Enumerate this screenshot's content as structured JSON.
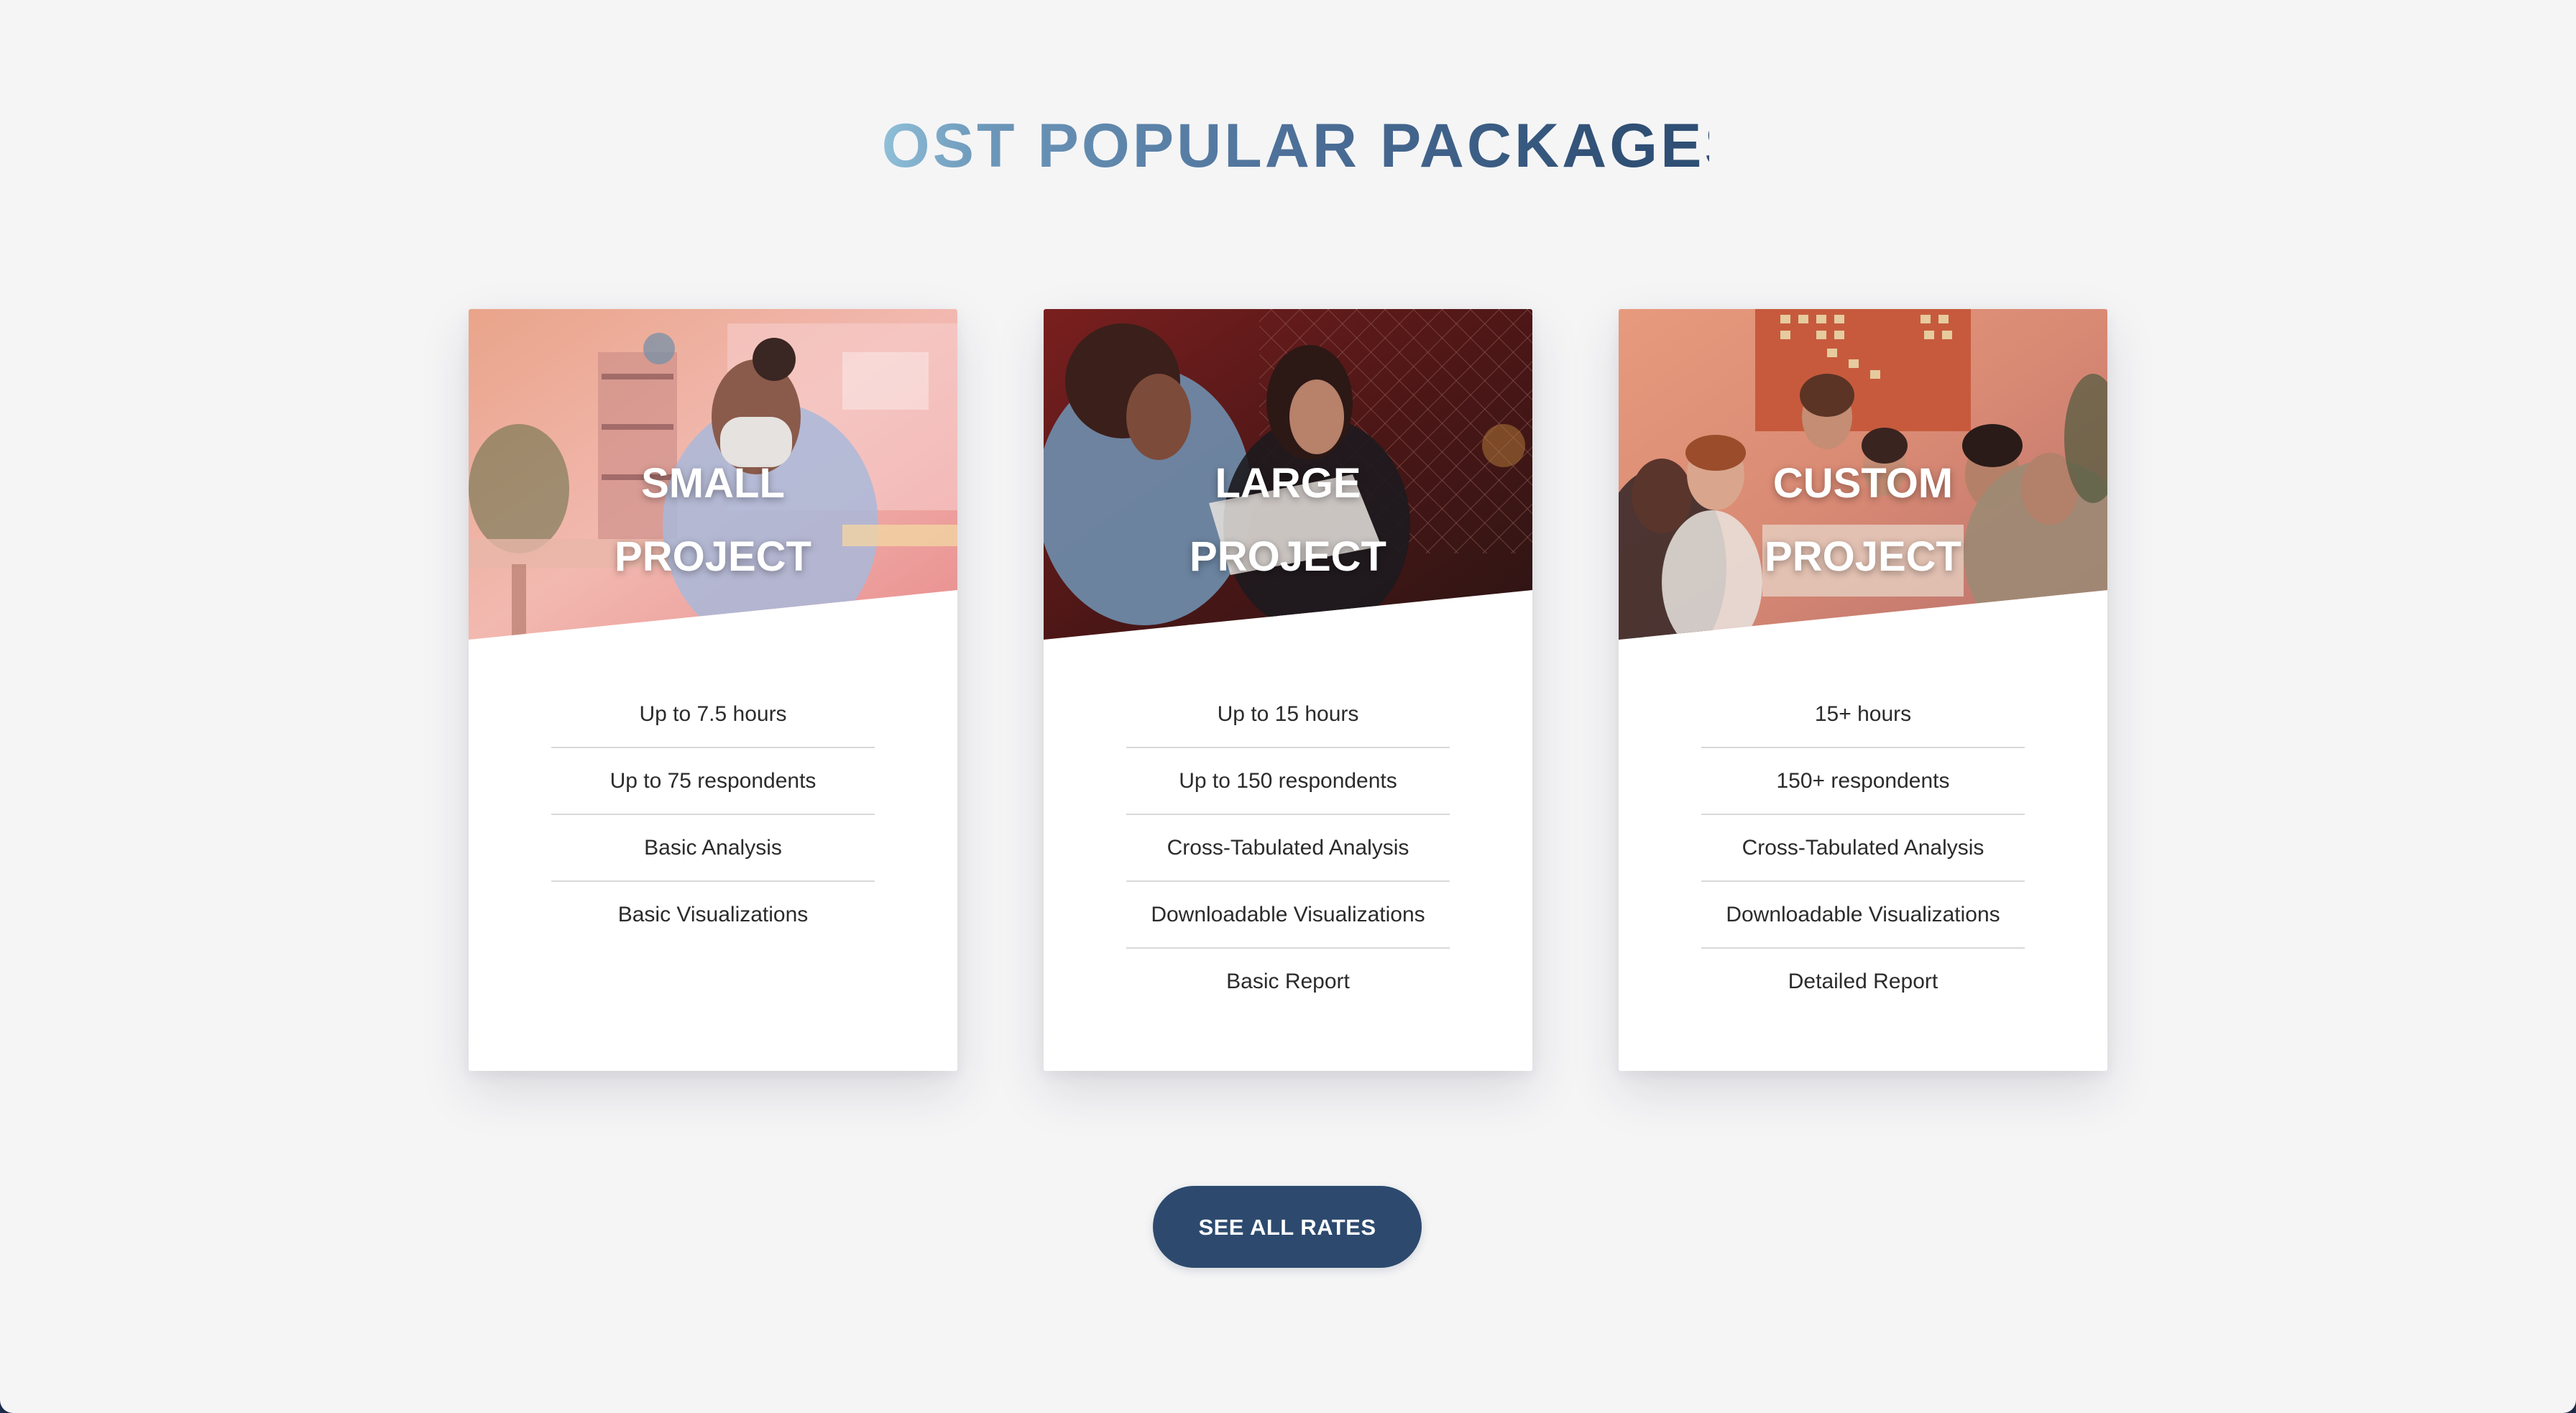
{
  "section": {
    "title": "MOST POPULAR PACKAGES"
  },
  "packages": [
    {
      "title_line1": "SMALL",
      "title_line2": "PROJECT",
      "features": [
        "Up to 7.5 hours",
        "Up to 75 respondents",
        "Basic Analysis",
        "Basic Visualizations"
      ]
    },
    {
      "title_line1": "LARGE",
      "title_line2": "PROJECT",
      "features": [
        "Up to 15 hours",
        "Up to 150 respondents",
        "Cross-Tabulated Analysis",
        "Downloadable Visualizations",
        "Basic Report"
      ]
    },
    {
      "title_line1": "CUSTOM",
      "title_line2": "PROJECT",
      "features": [
        "15+ hours",
        "150+ respondents",
        "Cross-Tabulated Analysis",
        "Downloadable Visualizations",
        "Detailed Report"
      ]
    }
  ],
  "cta": {
    "label": "SEE ALL RATES"
  },
  "colors": {
    "page_background": "#f5f5f6",
    "heading_light": "#8fbfd8",
    "heading_dark": "#2f4f74",
    "button": "#2d4a6e",
    "feature_text": "#2b2b2b"
  },
  "images": [
    {
      "icon": "student-with-mask-photo"
    },
    {
      "icon": "students-reading-photo"
    },
    {
      "icon": "team-meeting-photo"
    }
  ]
}
